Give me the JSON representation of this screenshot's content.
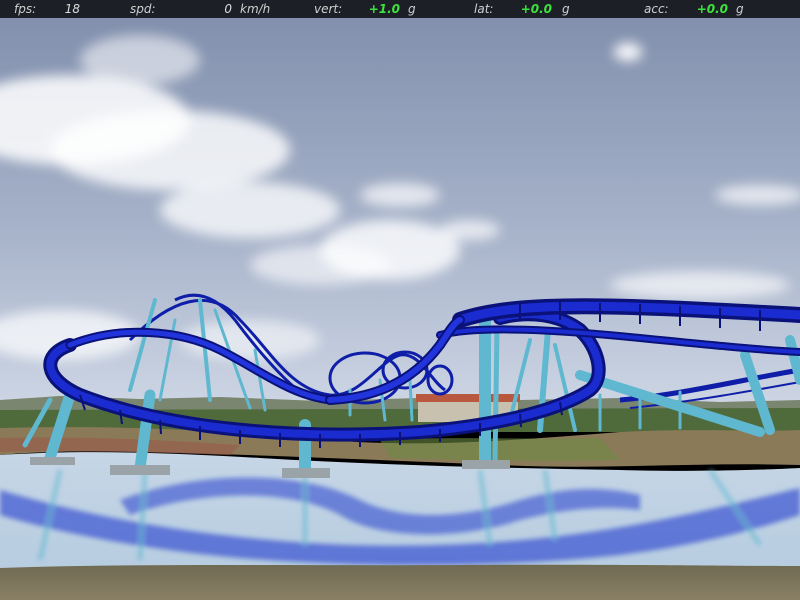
{
  "hud": {
    "fps_label": "fps:",
    "fps_value": "18",
    "spd_label": "spd:",
    "spd_value": "0",
    "spd_unit": "km/h",
    "vert_label": "vert:",
    "vert_value": "+1.0",
    "vert_unit": "g",
    "lat_label": "lat:",
    "lat_value": "+0.0",
    "lat_unit": "g",
    "acc_label": "acc:",
    "acc_value": "+0.0",
    "acc_unit": "g"
  },
  "colors": {
    "sky_top": "#7f8eaa",
    "sky_horizon": "#c9d3e3",
    "track": "#1525c8",
    "track_dark": "#0a127a",
    "support": "#5fb8cf",
    "water": "#bdd3e6",
    "gforce_value": "#3ee23e",
    "station_roof": "#b8583e"
  }
}
